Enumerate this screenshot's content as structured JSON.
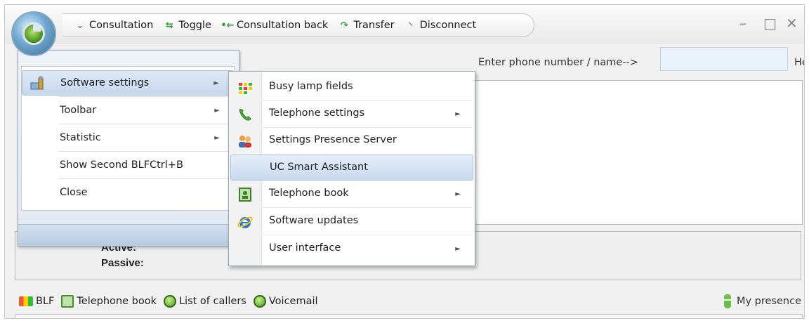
{
  "toolbar": {
    "consultation": "Consultation",
    "toggle": "Toggle",
    "consultation_back": "Consultation back",
    "transfer": "Transfer",
    "disconnect": "Disconnect"
  },
  "window_controls": {
    "minimize": "–",
    "maximize": "□",
    "close": "✕"
  },
  "search": {
    "label": "Enter phone number / name-->",
    "value": "",
    "help": "Help"
  },
  "main_menu": {
    "items": [
      {
        "label": "Software settings",
        "icon": "tools-icon",
        "has_submenu": true,
        "selected": true
      },
      {
        "label": "Toolbar",
        "has_submenu": true
      },
      {
        "label": "Statistic",
        "has_submenu": true
      },
      {
        "label": "Show Second BLF",
        "shortcut": "Ctrl+B"
      },
      {
        "label": "Close"
      }
    ]
  },
  "submenu": {
    "items": [
      {
        "label": "Busy lamp fields",
        "icon": "blf-icon"
      },
      {
        "label": "Telephone settings",
        "icon": "phone-handset-icon",
        "has_submenu": true
      },
      {
        "label": "Settings Presence Server",
        "icon": "presence-people-icon"
      },
      {
        "label": "UC Smart Assistant",
        "highlighted": true
      },
      {
        "label": "Telephone book",
        "icon": "phonebook-icon",
        "has_submenu": true
      },
      {
        "label": "Software updates",
        "icon": "internet-explorer-icon"
      },
      {
        "label": "User interface",
        "has_submenu": true
      }
    ]
  },
  "status": {
    "active": "Active:",
    "passive": "Passive:"
  },
  "bottom_bar": {
    "blf": "BLF",
    "telephone_book": "Telephone book",
    "list_of_callers": "List of callers",
    "voicemail": "Voicemail",
    "my_presence": "My presence"
  },
  "colors": {
    "menu_highlight": "#c9d9ee",
    "accent_green": "#4f9a22",
    "presence_green": "#6cc04a"
  }
}
